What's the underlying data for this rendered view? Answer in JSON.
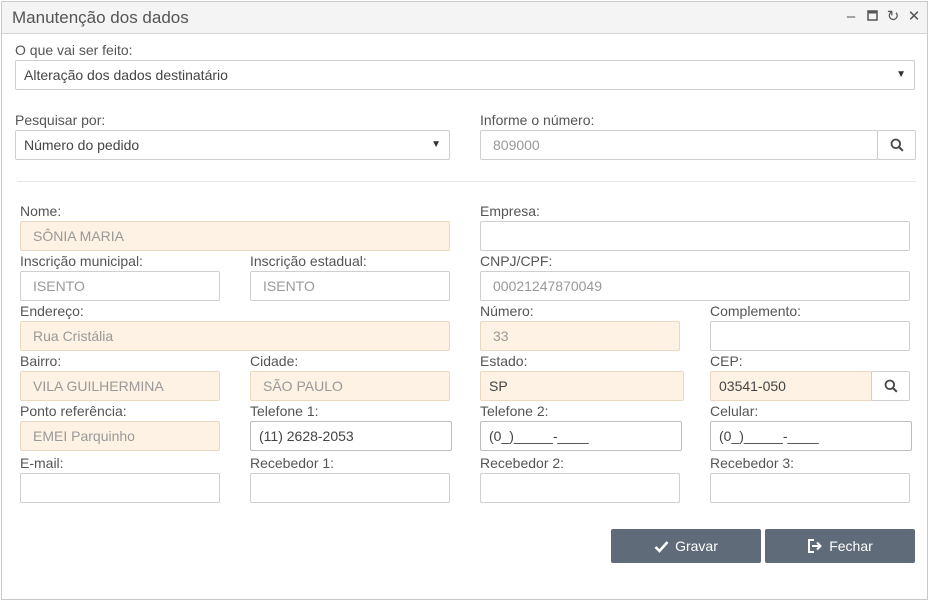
{
  "window": {
    "title": "Manutenção dos dados"
  },
  "form": {
    "action_label": "O que vai ser feito:",
    "action_value": "Alteração dos dados destinatário",
    "search_by_label": "Pesquisar por:",
    "search_by_value": "Número do pedido",
    "number_label": "Informe o número:",
    "number_value": "809000",
    "nome_label": "Nome:",
    "nome_value": "SÔNIA MARIA",
    "empresa_label": "Empresa:",
    "empresa_value": "",
    "insc_mun_label": "Inscrição municipal:",
    "insc_mun_value": "ISENTO",
    "insc_est_label": "Inscrição estadual:",
    "insc_est_value": "ISENTO",
    "cnpj_label": "CNPJ/CPF:",
    "cnpj_value": "00021247870049",
    "endereco_label": "Endereço:",
    "endereco_value": "Rua Cristália",
    "numero_label": "Número:",
    "numero_value": "33",
    "complemento_label": "Complemento:",
    "complemento_value": "",
    "bairro_label": "Bairro:",
    "bairro_value": "VILA GUILHERMINA",
    "cidade_label": "Cidade:",
    "cidade_value": "SÃO PAULO",
    "estado_label": "Estado:",
    "estado_value": "SP",
    "cep_label": "CEP:",
    "cep_value": "03541-050",
    "ponto_label": "Ponto referência:",
    "ponto_value": "EMEI Parquinho",
    "tel1_label": "Telefone 1:",
    "tel1_value": "(11) 2628-2053",
    "tel2_label": "Telefone 2:",
    "tel2_value": "(0_)_____-____",
    "celular_label": "Celular:",
    "celular_value": "(0_)_____-____",
    "email_label": "E-mail:",
    "email_value": "",
    "receb1_label": "Recebedor 1:",
    "receb1_value": "",
    "receb2_label": "Recebedor 2:",
    "receb2_value": "",
    "receb3_label": "Recebedor 3:",
    "receb3_value": ""
  },
  "buttons": {
    "save": "Gravar",
    "close": "Fechar"
  },
  "colors": {
    "readonly_bg": "#fdf2e3",
    "button_bg": "#5f6b78"
  }
}
